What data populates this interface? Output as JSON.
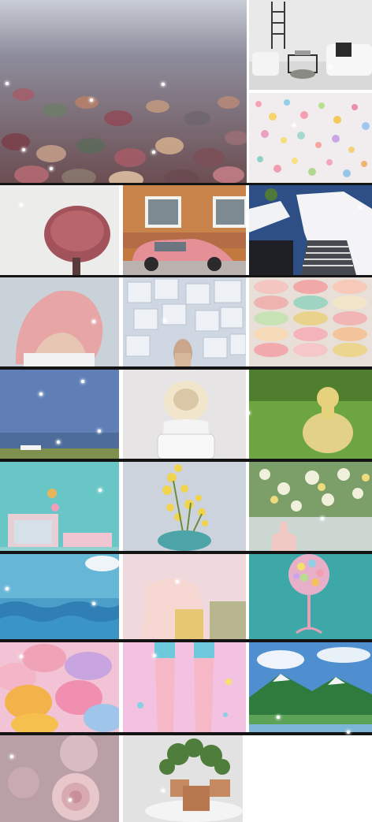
{
  "gallery": {
    "background_color": "#ffffff",
    "frame_color": "#141414",
    "tiles": [
      {
        "name": "pebbles-shore-photo",
        "icon": "pebbles-image"
      },
      {
        "name": "white-living-room-photo",
        "icon": "interior-image"
      },
      {
        "name": "confetti-photo",
        "icon": "confetti-image"
      },
      {
        "name": "pink-umbrella-photo",
        "icon": "umbrella-image"
      },
      {
        "name": "pink-car-photo",
        "icon": "car-image"
      },
      {
        "name": "white-stairs-photo",
        "icon": "stairs-image"
      },
      {
        "name": "pink-hair-photo",
        "icon": "hair-image"
      },
      {
        "name": "white-cubes-photo",
        "icon": "cubes-image"
      },
      {
        "name": "macarons-stack-photo",
        "icon": "macarons-image"
      },
      {
        "name": "blue-sky-field-photo",
        "icon": "sky-image"
      },
      {
        "name": "sun-hat-photo",
        "icon": "hat-image"
      },
      {
        "name": "duckling-photo",
        "icon": "duckling-image"
      },
      {
        "name": "teal-desk-photo",
        "icon": "desk-image"
      },
      {
        "name": "yellow-flowers-vase-photo",
        "icon": "vase-image"
      },
      {
        "name": "white-roses-hand-photo",
        "icon": "roses-image"
      },
      {
        "name": "ocean-waves-photo",
        "icon": "waves-image"
      },
      {
        "name": "pastel-girl-photo",
        "icon": "girl-image"
      },
      {
        "name": "candy-balloon-photo",
        "icon": "candy-image"
      },
      {
        "name": "colorful-macarons-photo",
        "icon": "macarons-image"
      },
      {
        "name": "pastel-legs-photo",
        "icon": "legs-image"
      },
      {
        "name": "mountain-lake-photo",
        "icon": "mountain-image"
      },
      {
        "name": "pink-rose-photo",
        "icon": "rose-image"
      },
      {
        "name": "potted-plants-photo",
        "icon": "plants-image"
      }
    ]
  }
}
